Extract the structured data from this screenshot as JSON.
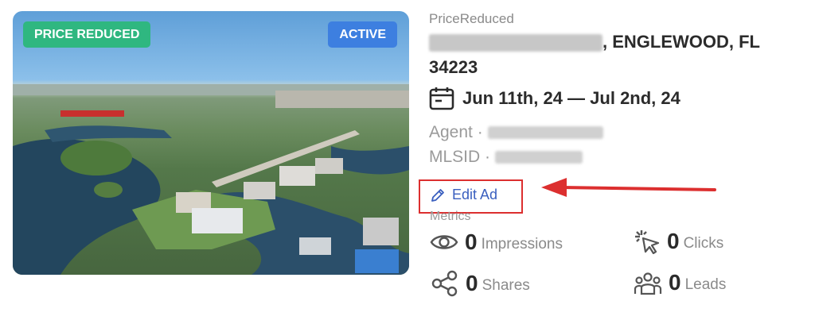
{
  "listing": {
    "badge_status": "PRICE REDUCED",
    "badge_active": "ACTIVE",
    "status_text": "PriceReduced",
    "address_suffix": ", ENGLEWOOD, FL",
    "address_zip": "34223",
    "dates": "Jun 11th, 24 — Jul 2nd, 24",
    "agent_label": "Agent ·",
    "mlsid_label": "MLSID ·"
  },
  "actions": {
    "edit_ad": "Edit Ad"
  },
  "metrics": {
    "label": "Metrics",
    "impressions": {
      "value": "0",
      "label": "Impressions",
      "icon": "eye-icon"
    },
    "clicks": {
      "value": "0",
      "label": "Clicks",
      "icon": "cursor-click-icon"
    },
    "shares": {
      "value": "0",
      "label": "Shares",
      "icon": "share-icon"
    },
    "leads": {
      "value": "0",
      "label": "Leads",
      "icon": "people-group-icon"
    }
  },
  "colors": {
    "badge_green": "#2fb780",
    "badge_blue": "#3d7fe0",
    "link_blue": "#3a5fbf",
    "annotation_red": "#dc2f2f"
  }
}
